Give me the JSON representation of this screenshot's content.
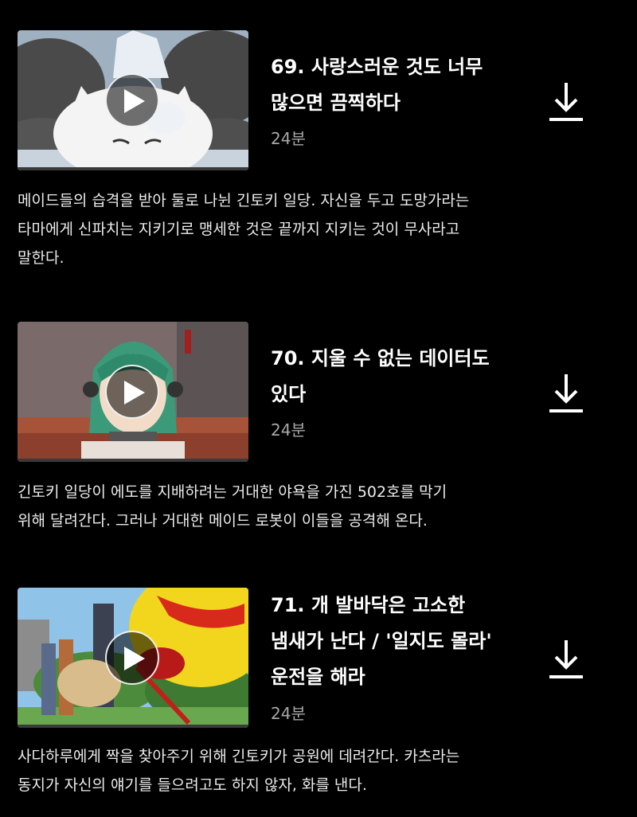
{
  "episodes": [
    {
      "title": "69. 사랑스러운 것도 너무\n많으면 끔찍하다",
      "duration": "24분",
      "description": "메이드들의 습격을 받아 둘로 나뉜 긴토키 일당. 자신을 두고 도망가라는\n타마에게 신파치는 지키기로 맹세한 것은 끝까지 지키는 것이 무사라고\n말한다."
    },
    {
      "title": "70. 지울 수 없는 데이터도\n있다",
      "duration": "24분",
      "description": "긴토키 일당이 에도를 지배하려는 거대한 야욕을 가진 502호를 막기\n위해 달려간다. 그러나 거대한 메이드 로봇이 이들을 공격해 온다."
    },
    {
      "title": "71. 개 발바닥은 고소한\n냄새가 난다 / '일지도 몰라'\n운전을 해라",
      "duration": "24분",
      "description": "사다하루에게 짝을 찾아주기 위해 긴토키가 공원에 데려간다. 카츠라는\n동지가 자신의 얘기를 들으려고도 하지 않자, 화를 낸다."
    }
  ],
  "icons": {
    "play": "play-icon",
    "download": "download-icon"
  },
  "colors": {
    "background": "#000000",
    "title": "#ffffff",
    "duration": "#a8a8a8",
    "description": "#ececec"
  }
}
